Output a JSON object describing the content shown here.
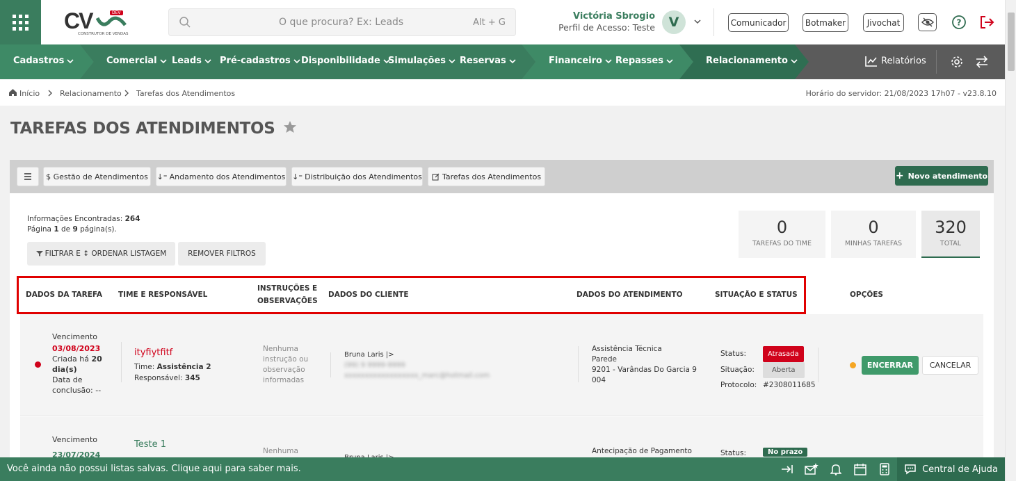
{
  "header": {
    "search_placeholder": "O que procura? Ex: Leads",
    "search_shortcut": "Alt + G",
    "logo_text": "CV",
    "logo_sub": "CONSTRUTOR DE VENDAS",
    "logo_badge": "DEV",
    "user_name": "Victória Sbrogio",
    "user_profile": "Perfil de Acesso: Teste",
    "avatar_letter": "V",
    "buttons": {
      "comunicador": "Comunicador",
      "botmaker": "Botmaker",
      "jivochat": "Jivochat"
    }
  },
  "nav": {
    "items": [
      "Cadastros",
      "Comercial",
      "Leads",
      "Pré-cadastros",
      "Disponibilidade",
      "Simulações",
      "Reservas",
      "Financeiro",
      "Repasses",
      "Relacionamento"
    ],
    "relatorios": "Relatórios"
  },
  "breadcrumb": {
    "items": [
      "Início",
      "Relacionamento",
      "Tarefas dos Atendimentos"
    ],
    "server_time": "Horário do servidor: 21/08/2023 17h07 - v23.8.10"
  },
  "page_title": "TAREFAS DOS ATENDIMENTOS",
  "toolbar": {
    "tabs": [
      "$ Gestão de Atendimentos",
      "Andamento dos Atendimentos",
      "Distribuição dos Atendimentos",
      "Tarefas dos Atendimentos"
    ],
    "new_button": "Novo atendimento"
  },
  "summary": {
    "found_label": "Informações Encontradas:",
    "found_value": "264",
    "page_prefix": "Página",
    "page_num": "1",
    "page_of": "de",
    "page_total": "9",
    "page_suffix": "página(s).",
    "filter_button": "FILTRAR E ↕ ORDENAR LISTAGEM",
    "remove_filters": "REMOVER FILTROS"
  },
  "stats": [
    {
      "value": "0",
      "label": "TAREFAS DO TIME"
    },
    {
      "value": "0",
      "label": "MINHAS TAREFAS"
    },
    {
      "value": "320",
      "label": "TOTAL"
    }
  ],
  "columns": [
    "DADOS DA TAREFA",
    "TIME E RESPONSÁVEL",
    "INSTRUÇÕES E",
    "OBSERVAÇÕES",
    "DADOS DO CLIENTE",
    "DADOS DO ATENDIMENTO",
    "SITUAÇÃO E STATUS",
    "OPÇÕES"
  ],
  "rows": [
    {
      "venc_label": "Vencimento",
      "venc_date": "03/08/2023",
      "criada": "Criada há",
      "criada_days": "20",
      "criada_unit": "dia(s)",
      "conclusao_label": "Data de",
      "conclusao_label2": "conclusão: --",
      "task_name": "ityfiytfitf",
      "time_label": "Time:",
      "time_value": "Assistência 2",
      "resp_label": "Responsável:",
      "resp_value": "345",
      "instr": [
        "Nenhuma",
        "instrução ou",
        "observação",
        "informadas"
      ],
      "client_name": "Bruna Laris |>",
      "client_phone": "(99) 9 9999-9999",
      "client_email": "xxxxxxxxxxxxxxxxxx_marc@hotmail.com",
      "atend": [
        "Assistência Técnica",
        "Parede",
        "9201 - Varândas Do Garcia 9",
        "004"
      ],
      "status_label": "Status:",
      "status_value": "Atrasada",
      "situacao_label": "Situação:",
      "situacao_value": "Aberta",
      "protocolo_label": "Protocolo:",
      "protocolo_value": "#2308011685",
      "btn_encerrar": "ENCERRAR",
      "btn_cancelar": "CANCELAR"
    },
    {
      "venc_label": "Vencimento",
      "venc_date": "23/07/2024",
      "task_name": "Teste 1",
      "instr1": "Nenhuma",
      "client_name": "Bruna Laris |>",
      "atend1": "Antecipação de Pagamento",
      "status_label": "Status:",
      "status_value": "No prazo"
    }
  ],
  "footer": {
    "message": "Você ainda não possui listas salvas. Clique aqui para saber mais.",
    "help": "Central de Ajuda"
  },
  "colors": {
    "green": "#3a7d5e",
    "dark_green": "#2e6b4f",
    "red": "#d0021b"
  }
}
